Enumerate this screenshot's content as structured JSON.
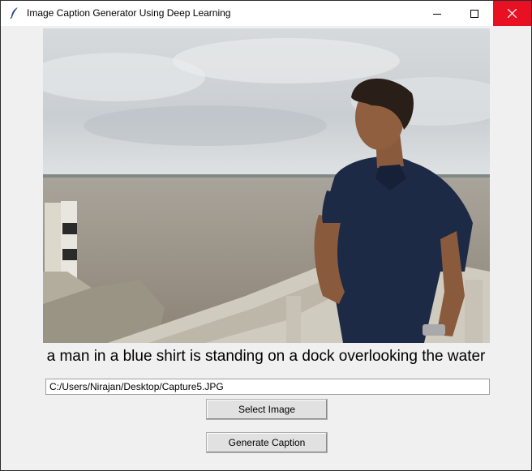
{
  "window": {
    "title": "Image Caption Generator Using Deep Learning",
    "controls": [
      "minimize",
      "maximize",
      "close"
    ],
    "close_color": "#e81123"
  },
  "image": {
    "description_icon": "photo-man-on-dock"
  },
  "caption": {
    "text": "a man in a blue shirt is standing on a dock overlooking the water"
  },
  "file_path": {
    "value": "C:/Users/Nirajan/Desktop/Capture5.JPG"
  },
  "buttons": {
    "select_image": "Select Image",
    "generate_caption": "Generate Caption"
  }
}
